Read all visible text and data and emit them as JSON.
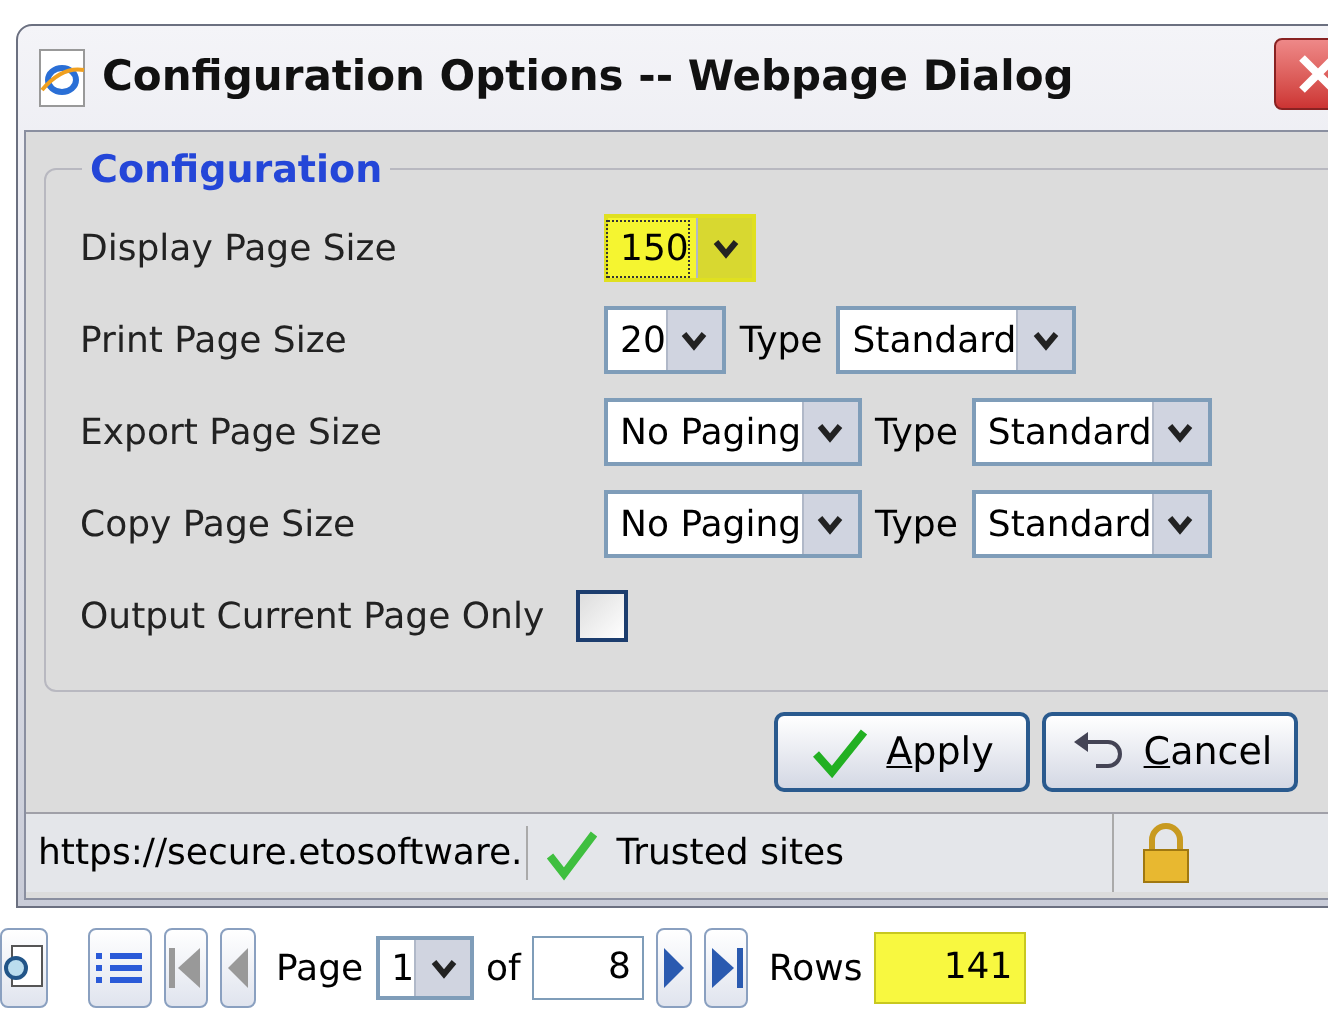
{
  "window": {
    "title": "Configuration Options -- Webpage Dialog"
  },
  "group": {
    "legend": "Configuration"
  },
  "rows": [
    {
      "kind": "single",
      "label": "Display Page Size",
      "value": "150",
      "highlighted": true
    },
    {
      "kind": "typed",
      "label": "Print Page Size",
      "value": "20",
      "type_label": "Type",
      "type_value": "Standard"
    },
    {
      "kind": "typed",
      "label": "Export Page Size",
      "value": "No Paging",
      "type_label": "Type",
      "type_value": "Standard"
    },
    {
      "kind": "typed",
      "label": "Copy Page Size",
      "value": "No Paging",
      "type_label": "Type",
      "type_value": "Standard"
    },
    {
      "kind": "checkbox",
      "label": "Output Current Page Only",
      "checked": false
    }
  ],
  "buttons": [
    {
      "kind": "apply",
      "label": "**A**pply"
    },
    {
      "kind": "cancel",
      "label": "**C**ancel"
    }
  ],
  "status_bar": {
    "url": "https://secure.etosoftware.",
    "zone": "Trusted sites"
  },
  "pager": {
    "page_label": "Page",
    "page": "1",
    "of_label": "of",
    "total": "8",
    "rows_label": "Rows",
    "rows": "141",
    "rows_highlighted": true
  }
}
